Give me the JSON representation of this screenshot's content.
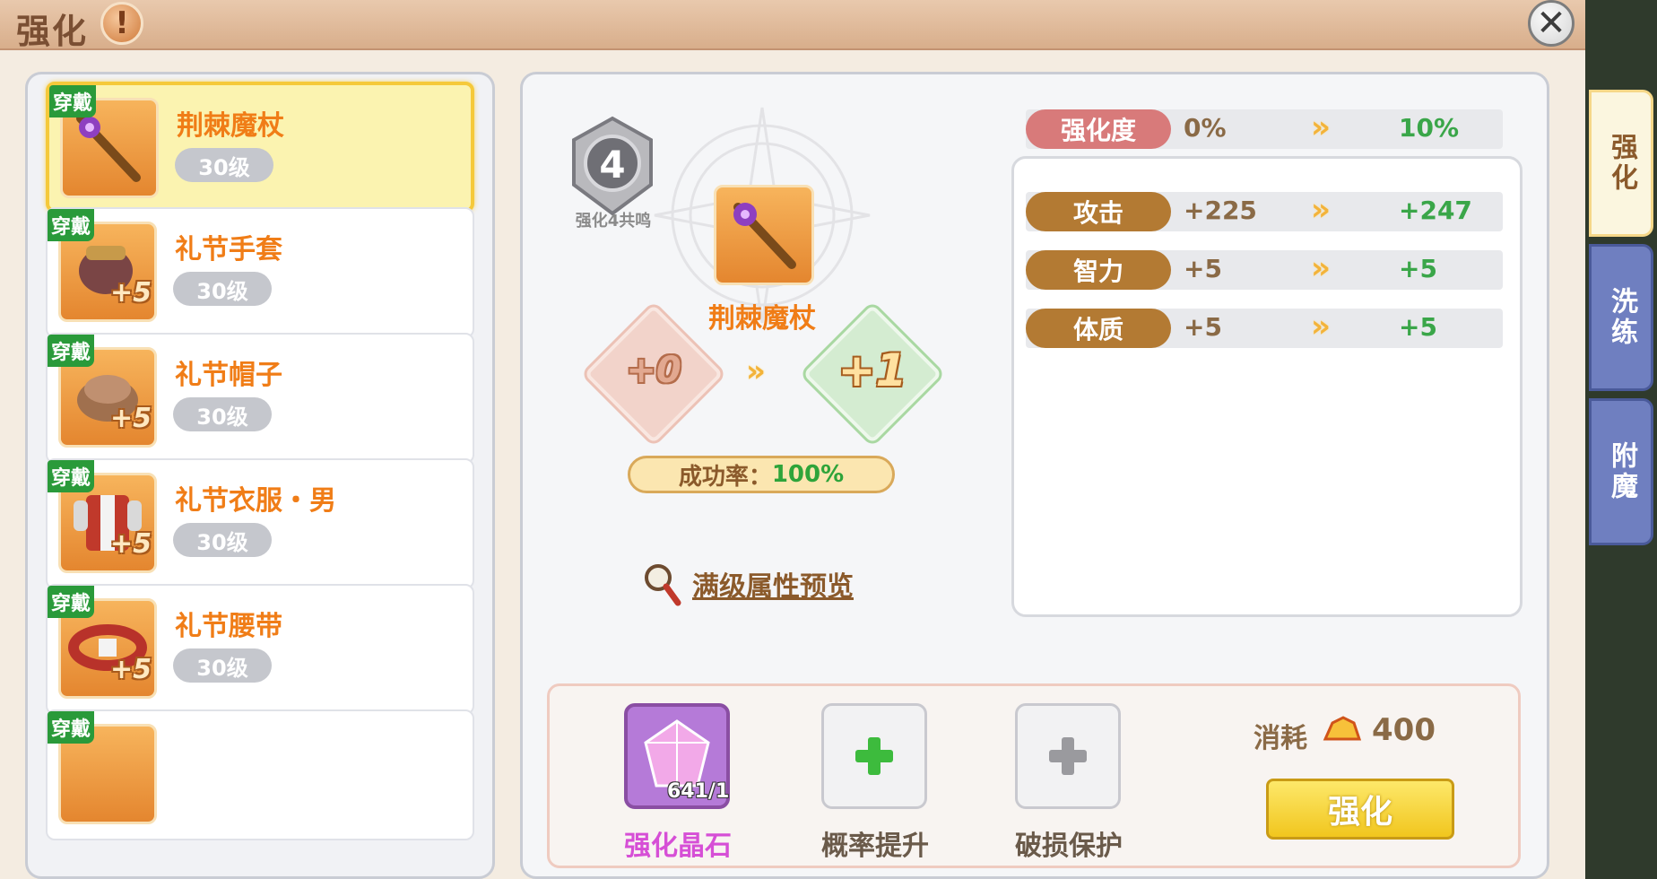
{
  "window": {
    "title": "强化",
    "close_label": "✕",
    "warn_label": "!"
  },
  "list": {
    "items": [
      {
        "tag": "穿戴",
        "name": "荆棘魔杖",
        "level": "30级",
        "plus": "",
        "selected": true
      },
      {
        "tag": "穿戴",
        "name": "礼节手套",
        "level": "30级",
        "plus": "+5"
      },
      {
        "tag": "穿戴",
        "name": "礼节帽子",
        "level": "30级",
        "plus": "+5"
      },
      {
        "tag": "穿戴",
        "name": "礼节衣服・男",
        "level": "30级",
        "plus": "+5"
      },
      {
        "tag": "穿戴",
        "name": "礼节腰带",
        "level": "30级",
        "plus": "+5"
      },
      {
        "tag": "穿戴",
        "name": "",
        "level": "",
        "plus": ""
      }
    ]
  },
  "center": {
    "resonance_number": "4",
    "resonance_label": "强化4共鸣",
    "item_name": "荆棘魔杖",
    "level_from": "+0",
    "level_to": "+1",
    "success_label": "成功率：",
    "success_value": "100%",
    "preview_label": "满级属性预览"
  },
  "stats": {
    "degree": {
      "label": "强化度",
      "current": "0%",
      "next": "10%"
    },
    "rows": [
      {
        "label": "攻击",
        "current": "+225",
        "next": "+247"
      },
      {
        "label": "智力",
        "current": "+5",
        "next": "+5"
      },
      {
        "label": "体质",
        "current": "+5",
        "next": "+5"
      }
    ]
  },
  "materials": {
    "crystal": {
      "count": "641/1",
      "caption": "强化晶石"
    },
    "rate_up": {
      "caption": "概率提升"
    },
    "protect": {
      "caption": "破损保护"
    },
    "cost_label": "消耗",
    "cost_value": "400",
    "enhance_button": "强化"
  },
  "tabs": [
    "强化",
    "洗练",
    "附魔"
  ],
  "colors": {
    "orange_text": "#f07d17",
    "green_text": "#2ea43a",
    "crystal_caption": "#d64fd6"
  }
}
